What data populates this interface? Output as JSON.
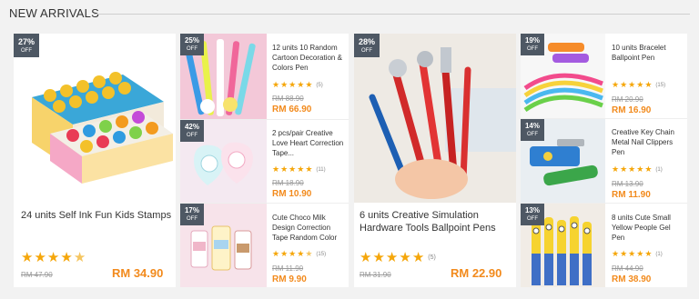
{
  "section": {
    "title": "NEW ARRIVALS"
  },
  "colors": {
    "accent": "#f28a1c",
    "star": "#f5a60a",
    "badge": "#4e5864"
  },
  "products": [
    {
      "name": "24 units Self Ink Fun Kids Stamps",
      "discount": "27%",
      "off": "OFF",
      "old_price": "RM 47.90",
      "price": "RM 34.90",
      "rating": 4.5,
      "reviews": "",
      "image": "stamps-photo"
    },
    {
      "name": "12 units 10 Random Cartoon Decoration & Colors Pen",
      "discount": "25%",
      "off": "OFF",
      "old_price": "RM 88.90",
      "price": "RM 66.90",
      "rating": 5,
      "reviews": "(5)",
      "image": "cartoon-pens-photo"
    },
    {
      "name": "2 pcs/pair Creative Love Heart Correction Tape...",
      "discount": "42%",
      "off": "OFF",
      "old_price": "RM 18.90",
      "price": "RM 10.90",
      "rating": 5,
      "reviews": "(11)",
      "image": "correction-tape-photo"
    },
    {
      "name": "Cute Choco Milk Design Correction Tape Random Color",
      "discount": "17%",
      "off": "OFF",
      "old_price": "RM 11.90",
      "price": "RM 9.90",
      "rating": 4.5,
      "reviews": "(15)",
      "image": "milk-tape-photo"
    },
    {
      "name": "6 units Creative Simulation Hardware Tools Ballpoint Pens",
      "discount": "28%",
      "off": "OFF",
      "old_price": "RM 31.90",
      "price": "RM 22.90",
      "rating": 5,
      "reviews": "(5)",
      "image": "tool-pens-photo"
    },
    {
      "name": "10 units Bracelet Ballpoint Pen",
      "discount": "19%",
      "off": "OFF",
      "old_price": "RM 20.90",
      "price": "RM 16.90",
      "rating": 5,
      "reviews": "(15)",
      "image": "bracelet-pen-photo"
    },
    {
      "name": "Creative Key Chain Metal Nail Clippers Pen",
      "discount": "14%",
      "off": "OFF",
      "old_price": "RM 13.90",
      "price": "RM 11.90",
      "rating": 5,
      "reviews": "(1)",
      "image": "clipper-pen-photo"
    },
    {
      "name": "8 units Cute Small Yellow People Gel Pen",
      "discount": "13%",
      "off": "OFF",
      "old_price": "RM 44.90",
      "price": "RM 38.90",
      "rating": 5,
      "reviews": "(1)",
      "image": "minion-pen-photo"
    }
  ]
}
